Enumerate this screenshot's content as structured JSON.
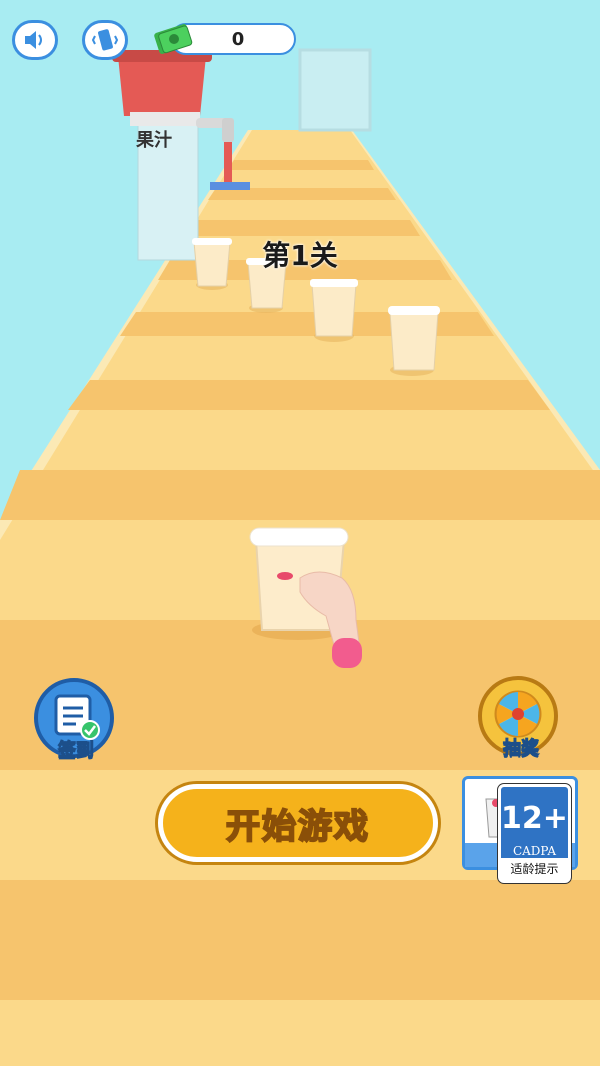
{
  "hud": {
    "sound_icon": "speaker-icon",
    "vibration_icon": "vibrate-phone-icon",
    "money": "0"
  },
  "scene": {
    "level_title": "第1关",
    "juice_label": "果汁",
    "colors": {
      "sky": "#a8ecf2",
      "track_light": "#fbd98a",
      "track_dark": "#f6c46d",
      "track_edge": "#fbe9b5",
      "button_blue": "#3b8fe0",
      "start_orange": "#f5b21b"
    }
  },
  "buttons": {
    "signin_label": "签到",
    "lottery_label": "抽奖",
    "start_label": "开始游戏"
  },
  "age_rating": {
    "rating": "12+",
    "org": "CADPA",
    "caption": "适龄提示"
  }
}
